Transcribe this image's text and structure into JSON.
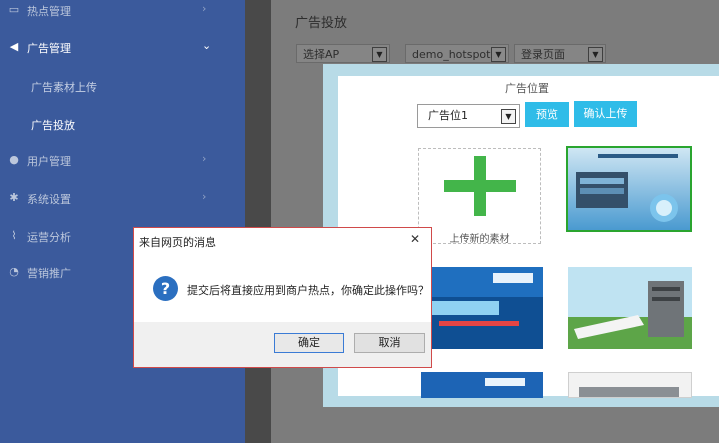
{
  "sidebar": {
    "items": [
      {
        "label": "热点管理",
        "icon": "monitor-icon"
      },
      {
        "label": "广告管理",
        "icon": "megaphone-icon"
      },
      {
        "label": "用户管理",
        "icon": "users-icon"
      },
      {
        "label": "系统设置",
        "icon": "gear-icon"
      },
      {
        "label": "运营分析",
        "icon": "line-chart-icon"
      },
      {
        "label": "营销推广",
        "icon": "pie-chart-icon"
      }
    ],
    "sub_items": [
      {
        "label": "广告素材上传"
      },
      {
        "label": "广告投放"
      }
    ]
  },
  "page": {
    "title": "广告投放",
    "filters": [
      "选择AP",
      "demo_hotspot",
      "登录页面"
    ]
  },
  "modal": {
    "title": "广告位置",
    "position_select": "广告位1",
    "preview_label": "预览",
    "confirm_upload_label": "确认上传",
    "upload_tile_label": "上传新的素材"
  },
  "dialog": {
    "title": "来自网页的消息",
    "message": "提交后将直接应用到商户热点，你确定此操作吗？",
    "ok_label": "确定",
    "cancel_label": "取消"
  },
  "colors": {
    "sidebar_bg": "#3b5a9c",
    "accent": "#2fbce8",
    "plus_green": "#43b54a",
    "selected_border": "#2aa52f"
  }
}
